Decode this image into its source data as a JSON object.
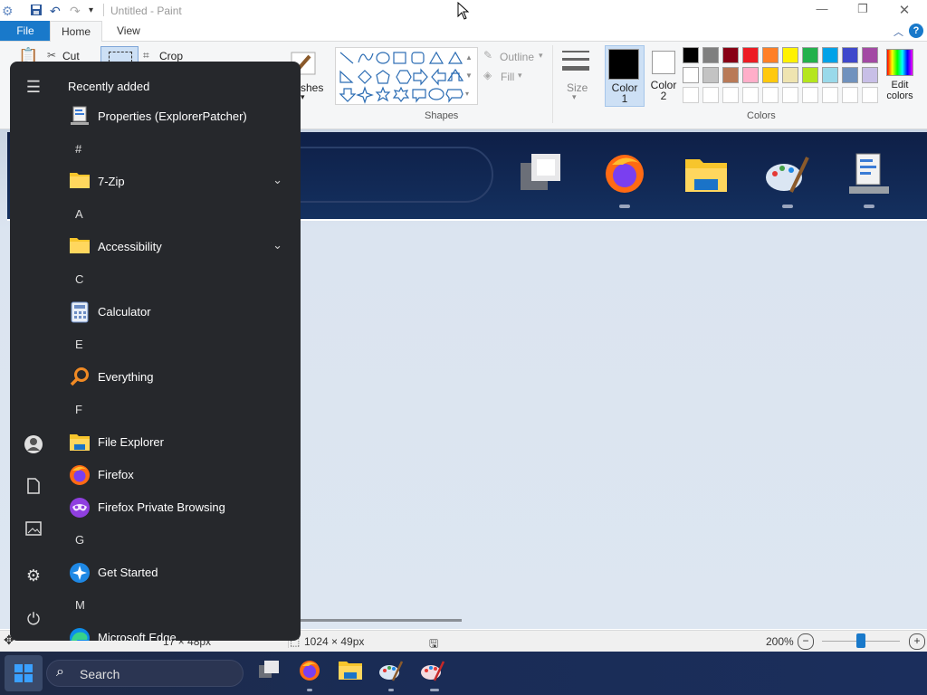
{
  "window": {
    "title": "Untitled - Paint"
  },
  "ribbon": {
    "tabs": [
      {
        "label": "File"
      },
      {
        "label": "Home"
      },
      {
        "label": "View"
      }
    ],
    "clipboard": {
      "cut_label": "Cut",
      "crop_label": "Crop"
    },
    "brushes_label": "shes",
    "shapes": {
      "group_label": "Shapes",
      "outline_label": "Outline",
      "fill_label": "Fill"
    },
    "size_label": "Size",
    "color1": {
      "line1": "Color",
      "line2": "1",
      "value": "#000000"
    },
    "color2": {
      "line1": "Color",
      "line2": "2",
      "value": "#ffffff"
    },
    "colors_label": "Colors",
    "edit_colors": {
      "line1": "Edit",
      "line2": "colors"
    },
    "palette_row1": [
      "#000000",
      "#7f7f7f",
      "#880015",
      "#ed1c24",
      "#ff7f27",
      "#fff200",
      "#22b14c",
      "#00a2e8",
      "#3f48cc",
      "#a349a4"
    ],
    "palette_row2": [
      "#ffffff",
      "#c3c3c3",
      "#b97a57",
      "#ffaec9",
      "#ffc90e",
      "#efe4b0",
      "#b5e61d",
      "#99d9ea",
      "#7092be",
      "#c8bfe7"
    ],
    "palette_row3": [
      "#ffffff",
      "#ffffff",
      "#ffffff",
      "#ffffff",
      "#ffffff",
      "#ffffff",
      "#ffffff",
      "#ffffff",
      "#ffffff",
      "#ffffff"
    ]
  },
  "status": {
    "cursor_position": "",
    "selection_size": "1024 × 49px",
    "selection_partial": "17 × 48px",
    "zoom": "200%",
    "zoom_level_fraction": 0.5
  },
  "start_menu": {
    "header": "Recently added",
    "items": [
      {
        "type": "app",
        "label": "Properties (ExplorerPatcher)",
        "icon": "properties-icon"
      },
      {
        "type": "letter",
        "label": "#"
      },
      {
        "type": "folder",
        "label": "7-Zip",
        "icon": "folder-icon"
      },
      {
        "type": "letter",
        "label": "A"
      },
      {
        "type": "folder",
        "label": "Accessibility",
        "icon": "folder-icon"
      },
      {
        "type": "letter",
        "label": "C"
      },
      {
        "type": "app",
        "label": "Calculator",
        "icon": "calculator-icon"
      },
      {
        "type": "letter",
        "label": "E"
      },
      {
        "type": "app",
        "label": "Everything",
        "icon": "search-magnifier-icon"
      },
      {
        "type": "letter",
        "label": "F"
      },
      {
        "type": "app",
        "label": "File Explorer",
        "icon": "file-explorer-icon"
      },
      {
        "type": "app",
        "label": "Firefox",
        "icon": "firefox-icon"
      },
      {
        "type": "app",
        "label": "Firefox Private Browsing",
        "icon": "firefox-private-icon"
      },
      {
        "type": "letter",
        "label": "G"
      },
      {
        "type": "app",
        "label": "Get Started",
        "icon": "get-started-icon"
      },
      {
        "type": "letter",
        "label": "M"
      },
      {
        "type": "app",
        "label": "Microsoft Edge",
        "icon": "edge-icon"
      }
    ]
  },
  "taskbar": {
    "search_label": "Search"
  }
}
